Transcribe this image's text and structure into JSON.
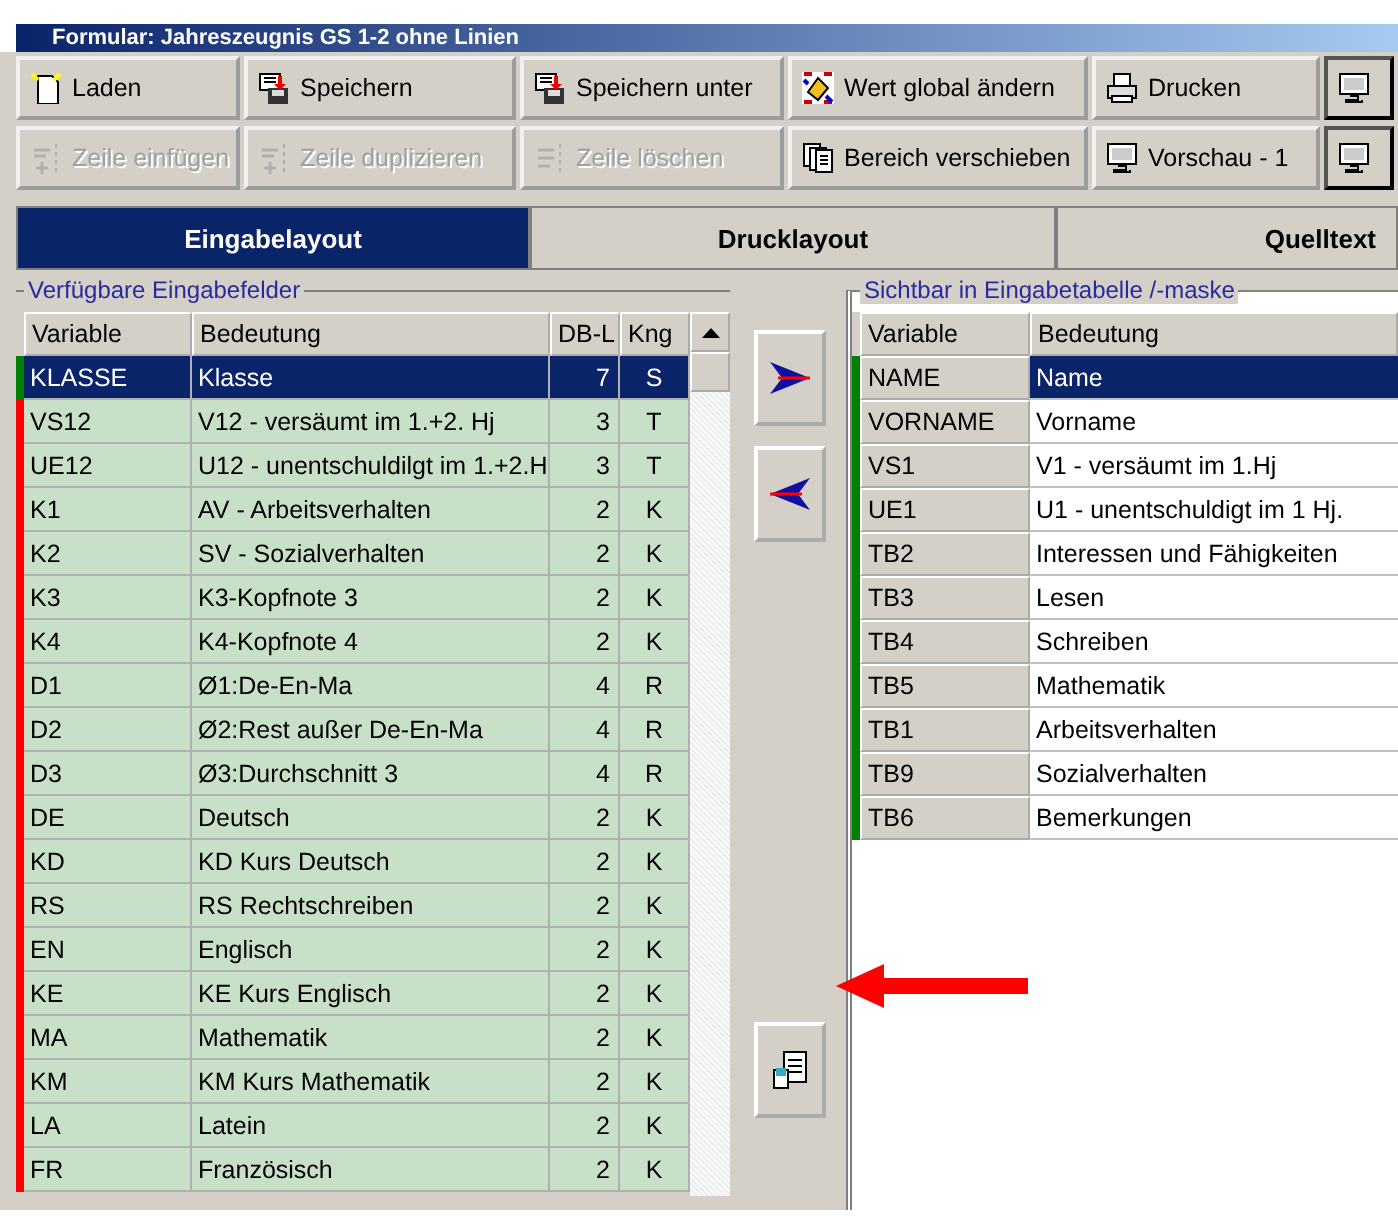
{
  "window": {
    "title": "Formular: Jahreszeugnis GS 1-2 ohne Linien"
  },
  "toolbar_rows": [
    [
      {
        "label": "Laden",
        "disabled": false
      },
      {
        "label": "Speichern",
        "disabled": false
      },
      {
        "label": "Speichern unter",
        "disabled": false
      },
      {
        "label": "Wert global ändern",
        "disabled": false
      },
      {
        "label": "Drucken",
        "disabled": false
      },
      {
        "disabled": false
      }
    ],
    [
      {
        "label": "Zeile einfügen",
        "disabled": true
      },
      {
        "label": "Zeile duplizieren",
        "disabled": true
      },
      {
        "label": "Zeile löschen",
        "disabled": true
      },
      {
        "label": "Bereich verschieben",
        "disabled": false
      },
      {
        "label": "Vorschau - 1",
        "disabled": false
      },
      {
        "disabled": false
      }
    ]
  ],
  "tabs": [
    {
      "label": "Eingabelayout",
      "selected": true
    },
    {
      "label": "Drucklayout",
      "selected": false
    },
    {
      "label": "Quelltext",
      "selected": false
    }
  ],
  "available_fields": {
    "title": "Verfügbare Eingabefelder",
    "columns": [
      "Variable",
      "Bedeutung",
      "DB-L",
      "Kng"
    ],
    "rows": [
      {
        "variable": "KLASSE",
        "meaning": "Klasse",
        "dbl": "7",
        "kng": "S",
        "color": "#008000",
        "selected": true
      },
      {
        "variable": "VS12",
        "meaning": "V12 - versäumt im 1.+2. Hj",
        "dbl": "3",
        "kng": "T",
        "color": "#ff0000",
        "selected": false
      },
      {
        "variable": "UE12",
        "meaning": "U12 - unentschuldilgt im 1.+2.H",
        "dbl": "3",
        "kng": "T",
        "color": "#ff0000",
        "selected": false
      },
      {
        "variable": "K1",
        "meaning": "AV - Arbeitsverhalten",
        "dbl": "2",
        "kng": "K",
        "color": "#ff0000",
        "selected": false
      },
      {
        "variable": "K2",
        "meaning": "SV - Sozialverhalten",
        "dbl": "2",
        "kng": "K",
        "color": "#ff0000",
        "selected": false
      },
      {
        "variable": "K3",
        "meaning": "K3-Kopfnote 3",
        "dbl": "2",
        "kng": "K",
        "color": "#ff0000",
        "selected": false
      },
      {
        "variable": "K4",
        "meaning": "K4-Kopfnote 4",
        "dbl": "2",
        "kng": "K",
        "color": "#ff0000",
        "selected": false
      },
      {
        "variable": "D1",
        "meaning": "Ø1:De-En-Ma",
        "dbl": "4",
        "kng": "R",
        "color": "#ff0000",
        "selected": false
      },
      {
        "variable": "D2",
        "meaning": "Ø2:Rest außer De-En-Ma",
        "dbl": "4",
        "kng": "R",
        "color": "#ff0000",
        "selected": false
      },
      {
        "variable": "D3",
        "meaning": "Ø3:Durchschnitt 3",
        "dbl": "4",
        "kng": "R",
        "color": "#ff0000",
        "selected": false
      },
      {
        "variable": "DE",
        "meaning": "Deutsch",
        "dbl": "2",
        "kng": "K",
        "color": "#ff0000",
        "selected": false
      },
      {
        "variable": "KD",
        "meaning": "KD Kurs Deutsch",
        "dbl": "2",
        "kng": "K",
        "color": "#ff0000",
        "selected": false
      },
      {
        "variable": "RS",
        "meaning": "RS Rechtschreiben",
        "dbl": "2",
        "kng": "K",
        "color": "#ff0000",
        "selected": false
      },
      {
        "variable": "EN",
        "meaning": "Englisch",
        "dbl": "2",
        "kng": "K",
        "color": "#ff0000",
        "selected": false
      },
      {
        "variable": "KE",
        "meaning": "KE Kurs Englisch",
        "dbl": "2",
        "kng": "K",
        "color": "#ff0000",
        "selected": false
      },
      {
        "variable": "MA",
        "meaning": "Mathematik",
        "dbl": "2",
        "kng": "K",
        "color": "#ff0000",
        "selected": false
      },
      {
        "variable": "KM",
        "meaning": "KM Kurs Mathematik",
        "dbl": "2",
        "kng": "K",
        "color": "#ff0000",
        "selected": false
      },
      {
        "variable": "LA",
        "meaning": "Latein",
        "dbl": "2",
        "kng": "K",
        "color": "#ff0000",
        "selected": false
      },
      {
        "variable": "FR",
        "meaning": "Französisch",
        "dbl": "2",
        "kng": "K",
        "color": "#ff0000",
        "selected": false
      }
    ]
  },
  "visible_fields": {
    "title": "Sichtbar in Eingabetabelle /-maske",
    "columns": [
      "Variable",
      "Bedeutung"
    ],
    "rows": [
      {
        "variable": "NAME",
        "meaning": "Name",
        "color": "#008000",
        "selected": true
      },
      {
        "variable": "VORNAME",
        "meaning": "Vorname",
        "color": "#008000",
        "selected": false
      },
      {
        "variable": "VS1",
        "meaning": "V1 - versäumt im 1.Hj",
        "color": "#008000",
        "selected": false
      },
      {
        "variable": "UE1",
        "meaning": "U1 - unentschuldigt im 1 Hj.",
        "color": "#008000",
        "selected": false
      },
      {
        "variable": "TB2",
        "meaning": "Interessen und Fähigkeiten",
        "color": "#008000",
        "selected": false
      },
      {
        "variable": "TB3",
        "meaning": "Lesen",
        "color": "#008000",
        "selected": false
      },
      {
        "variable": "TB4",
        "meaning": "Schreiben",
        "color": "#008000",
        "selected": false
      },
      {
        "variable": "TB5",
        "meaning": "Mathematik",
        "color": "#008000",
        "selected": false
      },
      {
        "variable": "TB1",
        "meaning": "Arbeitsverhalten",
        "color": "#008000",
        "selected": false
      },
      {
        "variable": "TB9",
        "meaning": "Sozialverhalten",
        "color": "#008000",
        "selected": false
      },
      {
        "variable": "TB6",
        "meaning": "Bemerkungen",
        "color": "#008000",
        "selected": false
      }
    ]
  },
  "transfer_buttons": [
    {
      "kind": "add"
    },
    {
      "kind": "remove"
    },
    {
      "kind": "copy"
    }
  ]
}
